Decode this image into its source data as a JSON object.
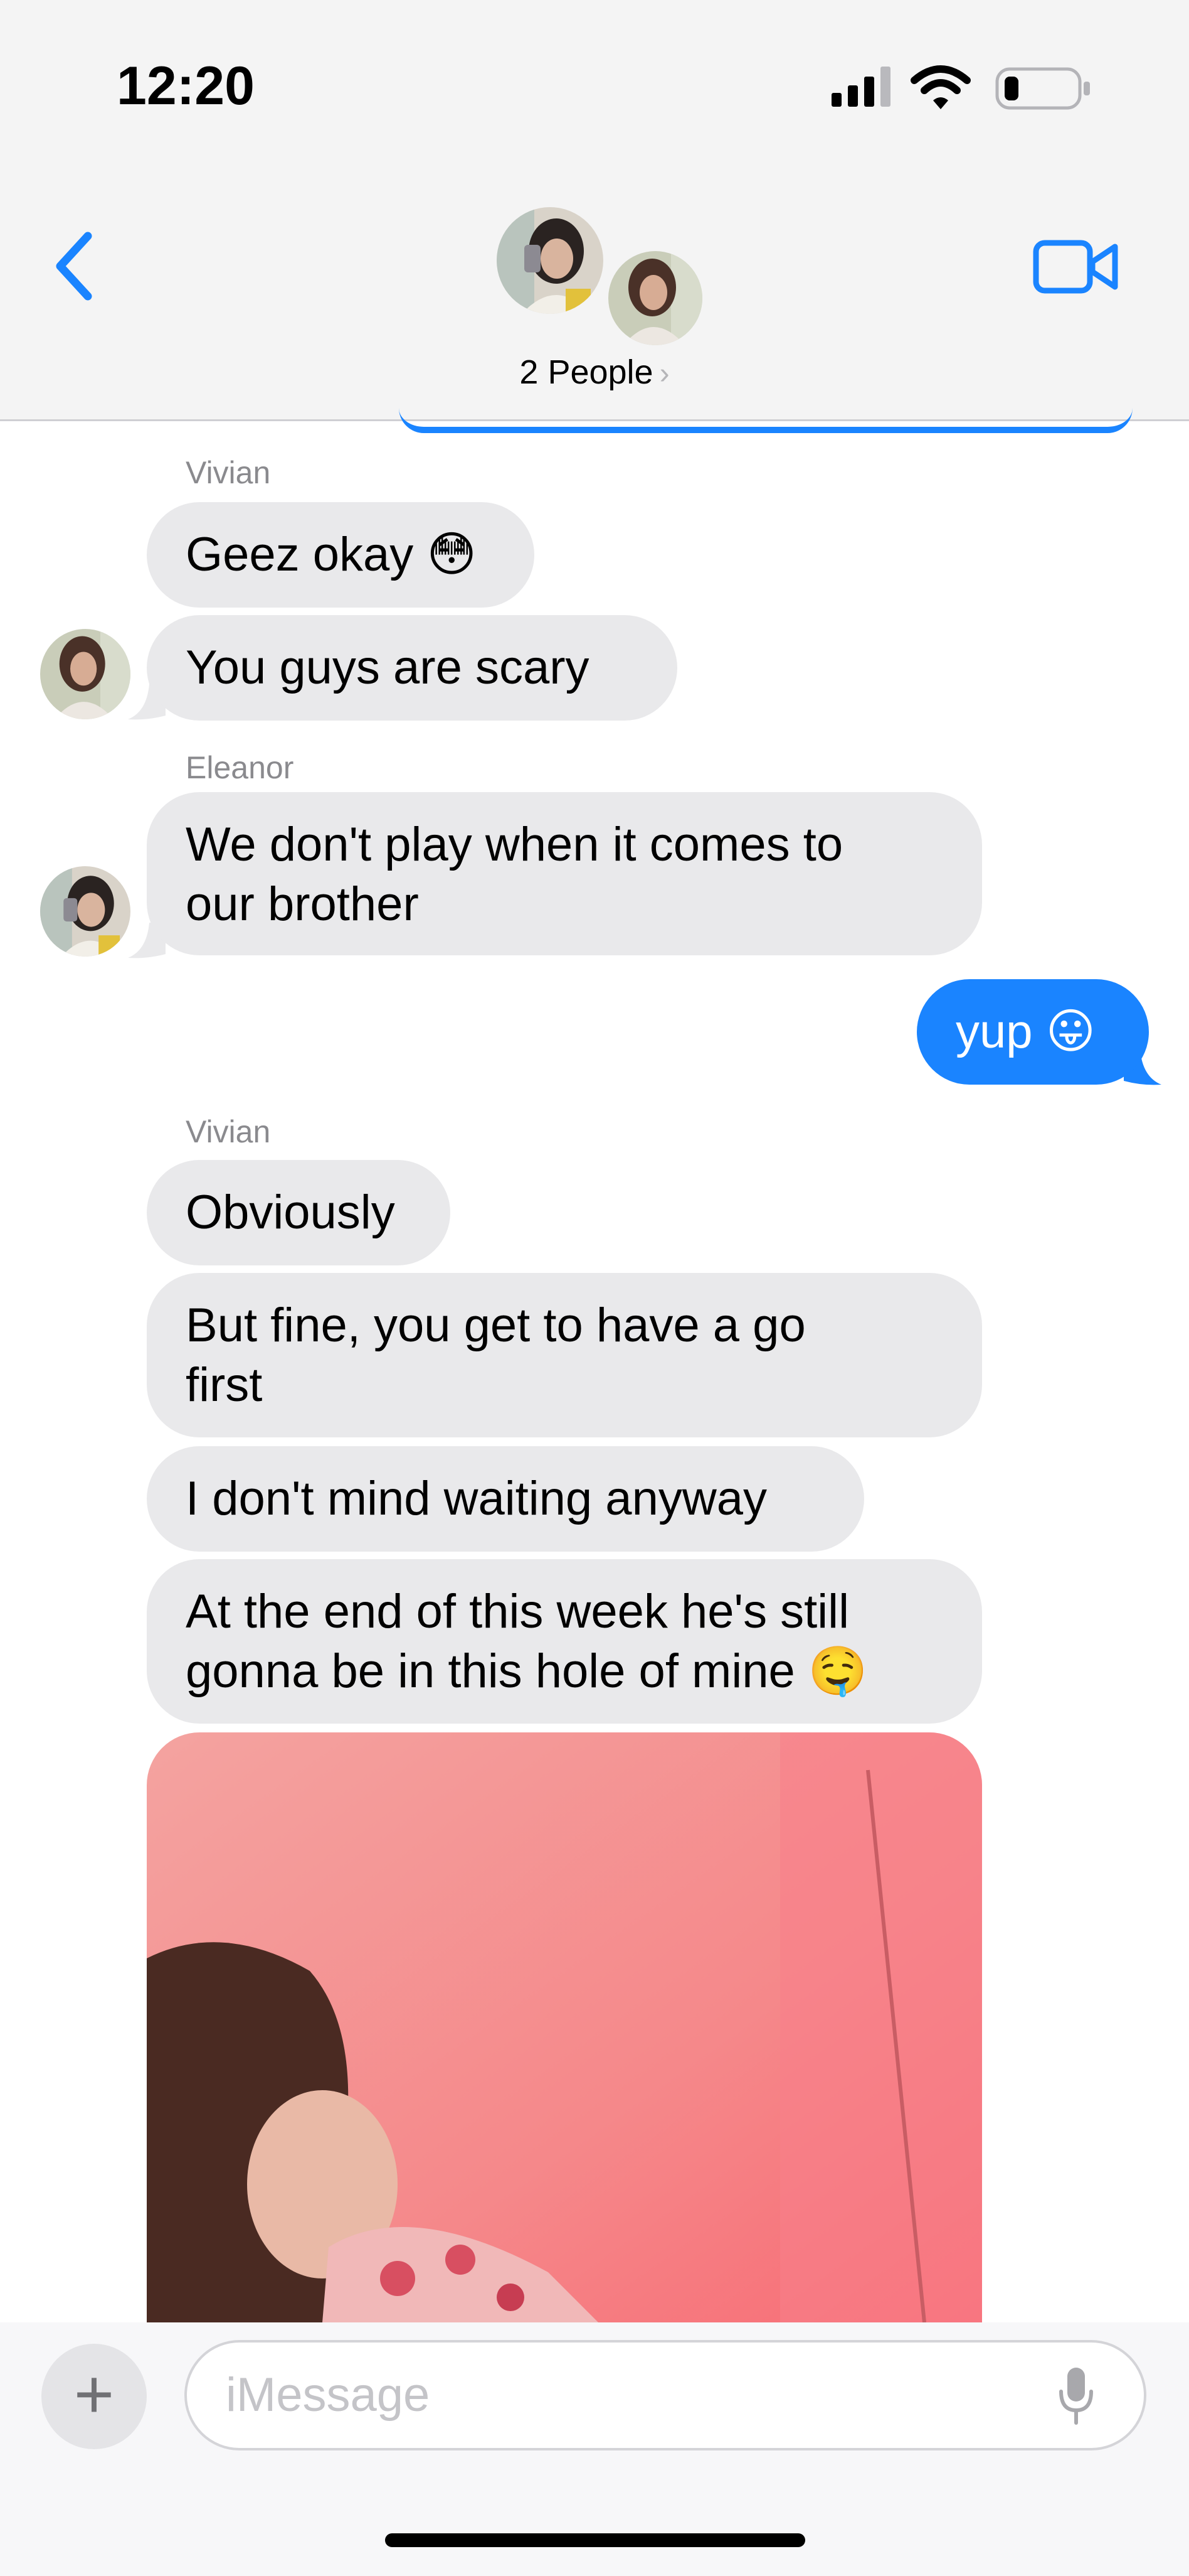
{
  "status_bar": {
    "time": "12:20",
    "battery_level": 0.2
  },
  "header": {
    "people_label": "2 People",
    "chevron": "›"
  },
  "messages": [
    {
      "sender": "Vivian",
      "text": "Geez okay",
      "emoji": "😳"
    },
    {
      "text": "You guys are scary"
    },
    {
      "sender": "Eleanor",
      "line1": "We don't play when it comes to",
      "line2": "our brother"
    },
    {
      "text": "yup",
      "emoji": "😛"
    },
    {
      "sender": "Vivian",
      "text": "Obviously"
    },
    {
      "line1": "But fine, you get to have a go",
      "line2": "first"
    },
    {
      "text": "I don't mind waiting anyway"
    },
    {
      "line1": "At the end of this week he's still",
      "line2": "gonna be in this hole of mine",
      "emoji": "🤤"
    }
  ],
  "composer": {
    "plus": "+",
    "placeholder": "iMessage"
  },
  "colors": {
    "outgoing": "#1a84ff",
    "incoming": "#e9e9eb",
    "accent": "#1a84ff"
  },
  "icons": [
    "back-chevron-icon",
    "video-call-icon",
    "signal-icon",
    "wifi-icon",
    "battery-icon",
    "microphone-icon",
    "plus-icon"
  ]
}
